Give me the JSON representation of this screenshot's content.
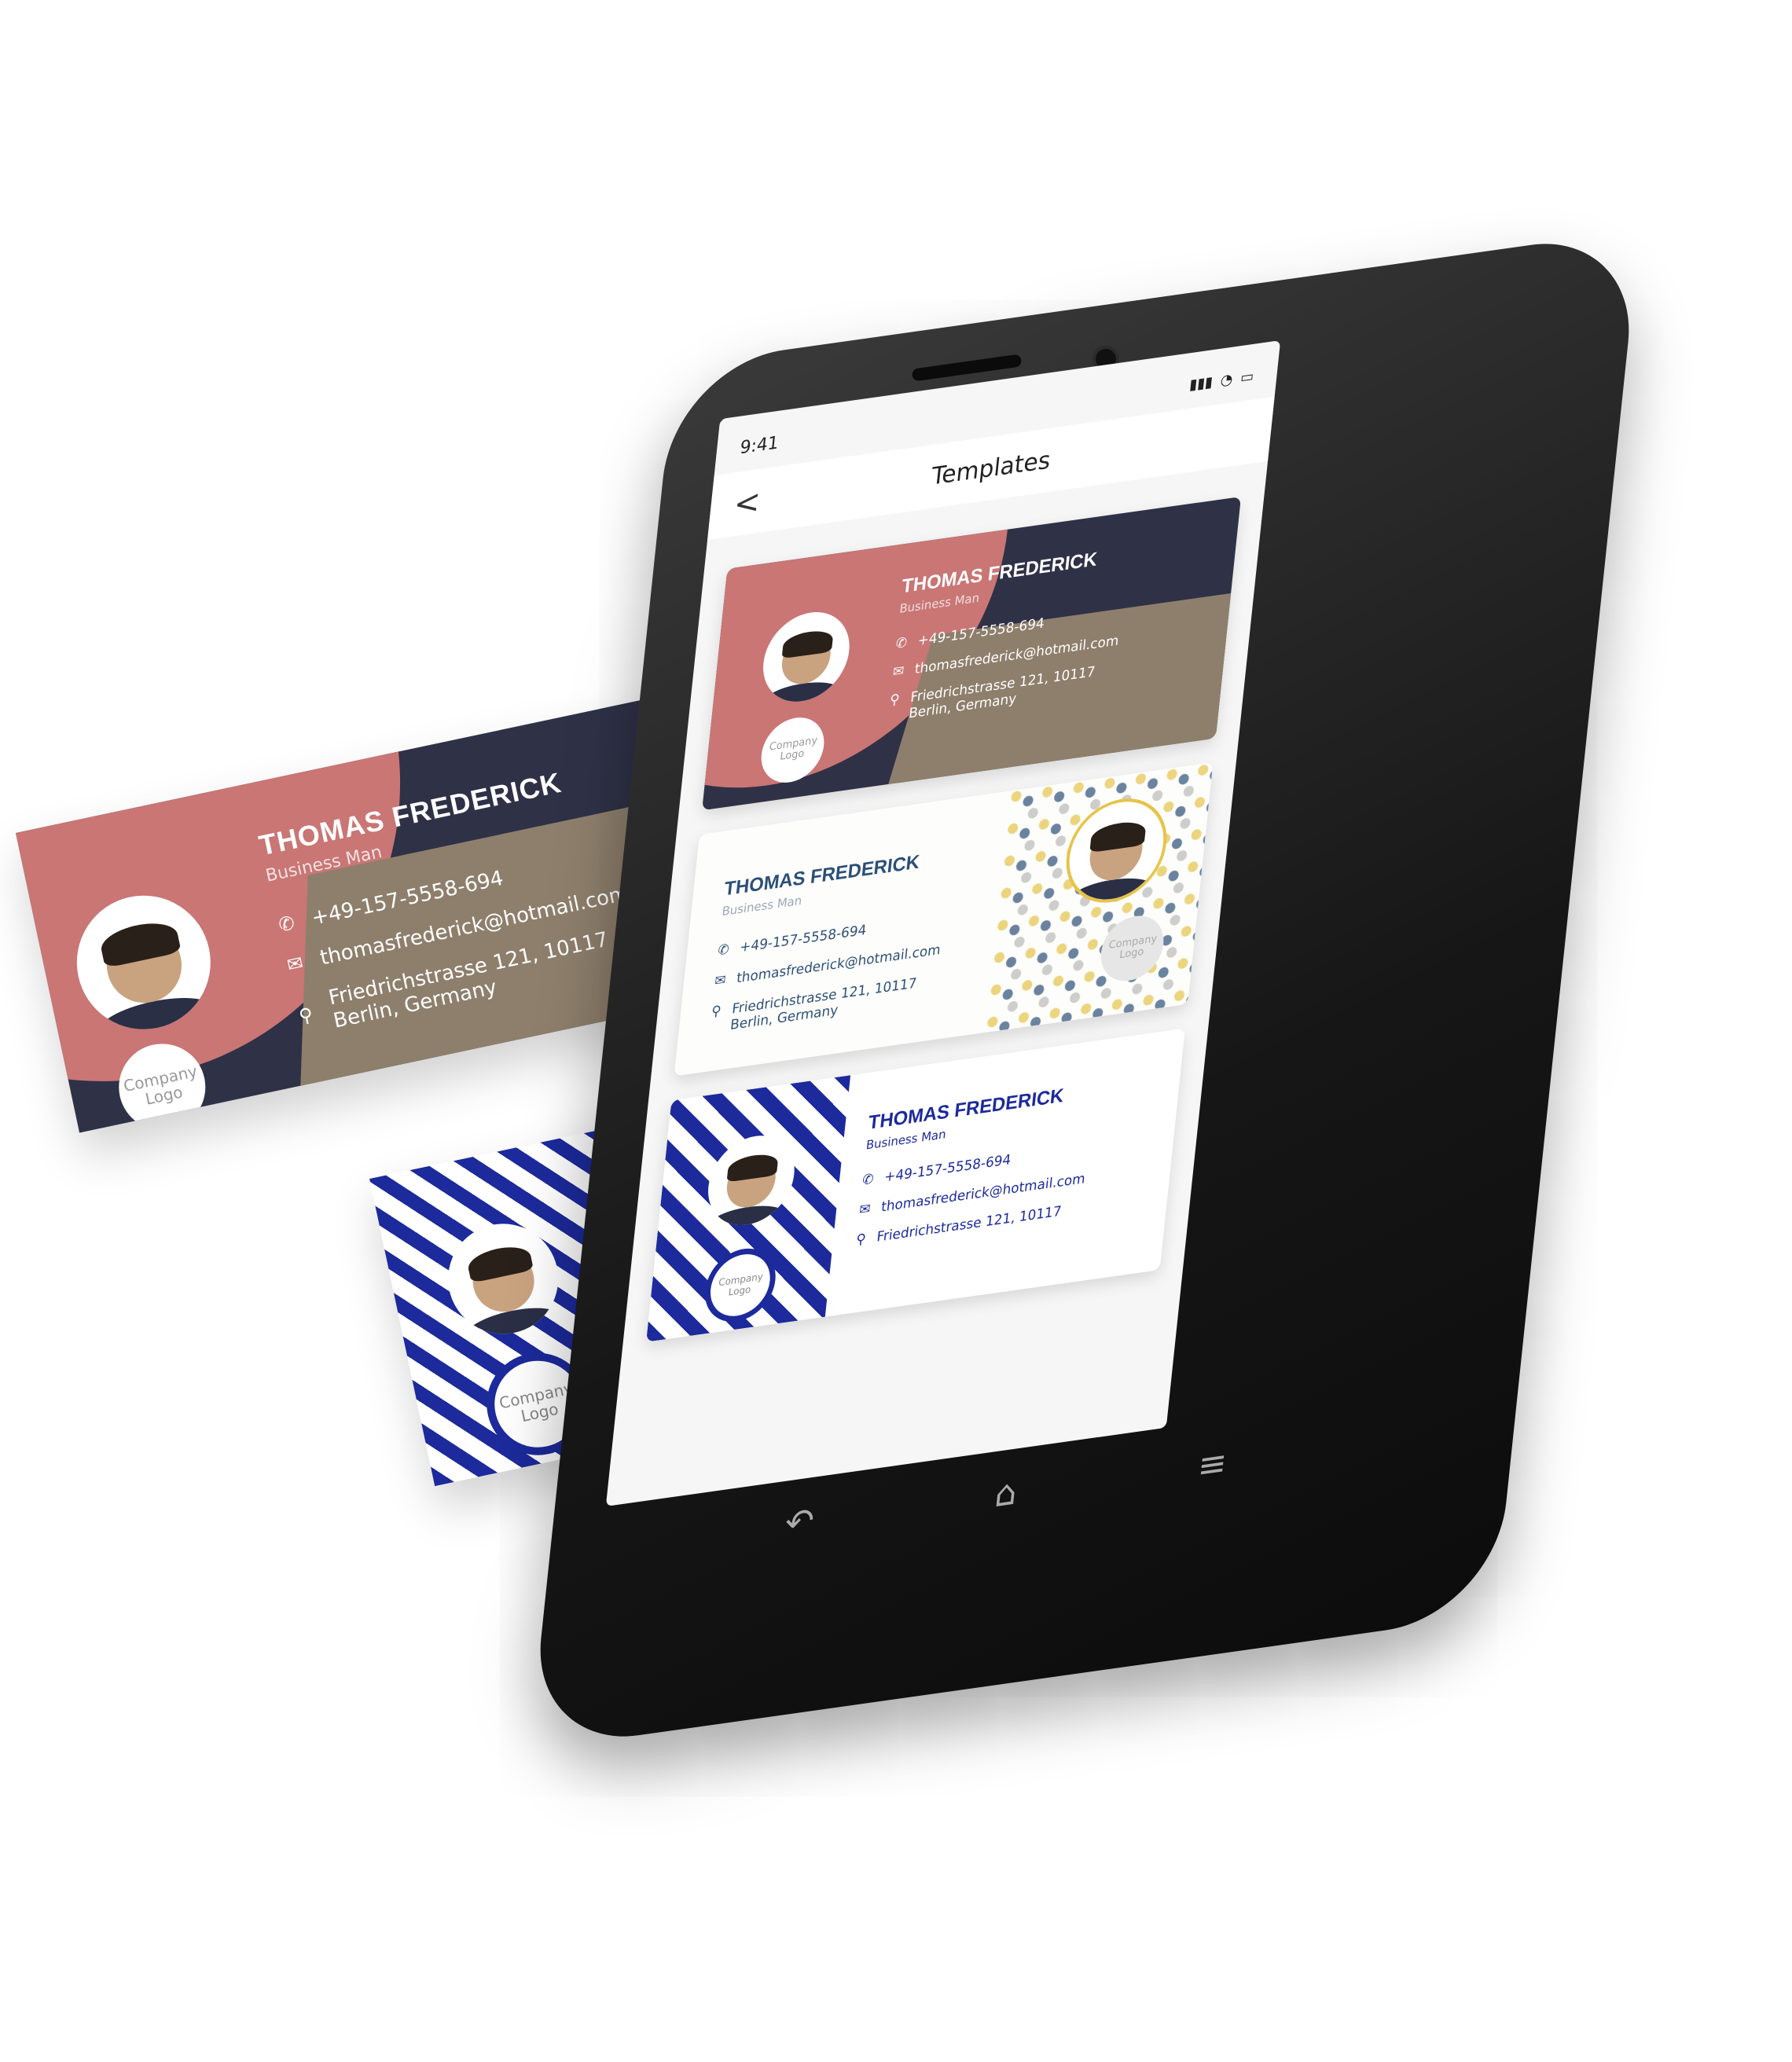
{
  "screen": {
    "status_time": "9:41",
    "title": "Templates",
    "back_label": "<"
  },
  "card": {
    "name": "THOMAS FREDERICK",
    "role": "Business Man",
    "phone": "+49-157-5558-694",
    "email": "thomasfrederick@hotmail.com",
    "address_line1": "Friedrichstrasse 121, 10117",
    "address_line2": "Berlin, Germany",
    "logo": "Company Logo"
  },
  "colors": {
    "pink": "#c97675",
    "navy": "#2f3147",
    "taupe": "#8e7f6c",
    "blue": "#1c2a9c",
    "gold": "#e6c44a"
  },
  "icons": {
    "phone": "phone-icon",
    "mail": "mail-icon",
    "location": "location-pin-icon",
    "back": "chevron-left-icon",
    "home": "home-icon",
    "undo": "back-navigation-icon",
    "menu": "menu-icon"
  },
  "nav": {
    "back_glyph": "↶",
    "home_glyph": "⌂",
    "menu_glyph": "≡"
  }
}
